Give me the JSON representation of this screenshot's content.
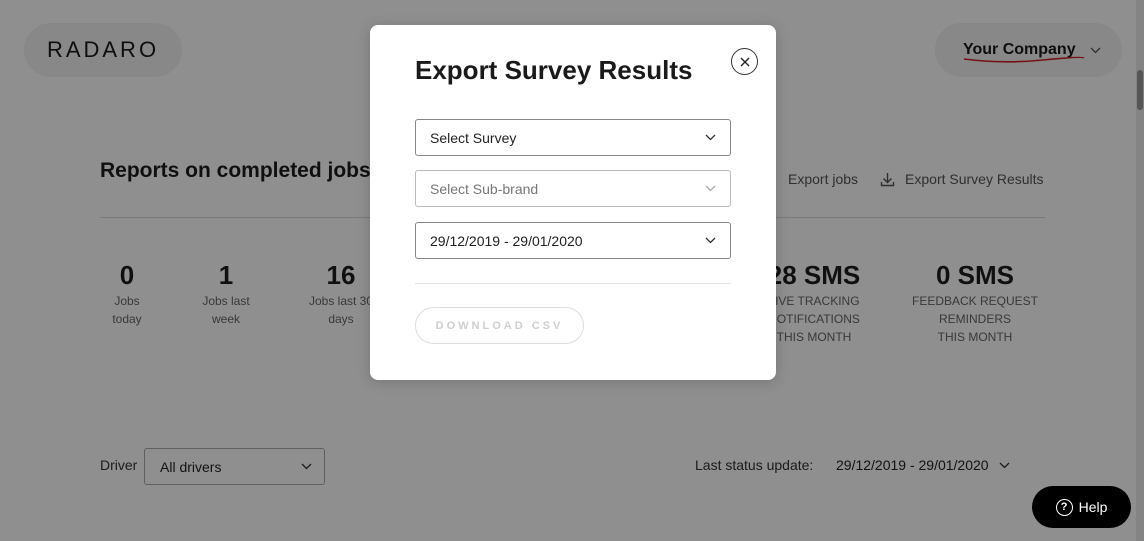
{
  "header": {
    "logo_text": "RADARO",
    "company_name": "Your Company",
    "company_underline_color": "#d0212a"
  },
  "page": {
    "title": "Reports on completed jobs",
    "actions": {
      "export_jobs": "Export jobs",
      "export_survey_results": "Export Survey Results"
    },
    "stats": [
      {
        "value": "0",
        "label": "Jobs\ntoday"
      },
      {
        "value": "1",
        "label": "Jobs last\nweek"
      },
      {
        "value": "16",
        "label": "Jobs last 30\ndays"
      },
      {
        "value": "28 SMS",
        "label": "LIVE TRACKING\nNOTIFICATIONS\nTHIS MONTH"
      },
      {
        "value": "0 SMS",
        "label": "FEEDBACK REQUEST\nREMINDERS\nTHIS MONTH"
      }
    ],
    "filters": {
      "driver_label": "Driver",
      "driver_value": "All drivers",
      "status_label": "Last status update:",
      "status_value": "29/12/2019 - 29/01/2020"
    }
  },
  "help": {
    "icon_text": "?",
    "label": "Help"
  },
  "modal": {
    "title": "Export Survey Results",
    "survey_select": "Select Survey",
    "subbrand_select": "Select Sub-brand",
    "date_range": "29/12/2019 - 29/01/2020",
    "download_label": "DOWNLOAD CSV"
  },
  "icons": {
    "close": "close-icon",
    "chevron": "chevron-down-icon",
    "download": "download-icon",
    "help": "question-circle-icon"
  }
}
